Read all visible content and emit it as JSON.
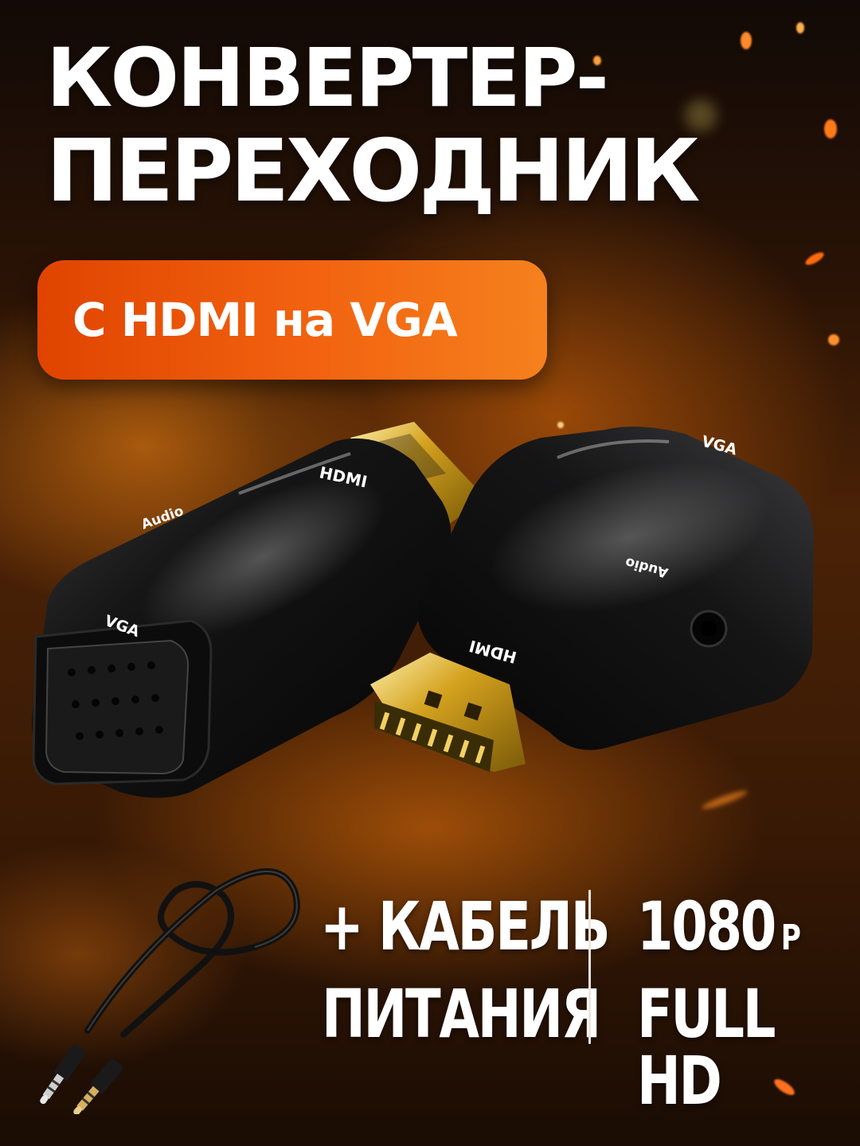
{
  "headline": {
    "line1": "КОНВЕРТЕР-",
    "line2": "ПЕРЕХОДНИК"
  },
  "badge": {
    "text": "С HDMI на VGA",
    "color_start": "#e04400",
    "color_end": "#f5811d"
  },
  "product": {
    "left_adapter": {
      "top_label": "HDMI",
      "side_label": "Audio",
      "front_label": "VGA"
    },
    "right_adapter": {
      "top_label": "VGA",
      "side_label": "Audio",
      "front_label": "HDMI"
    }
  },
  "features": {
    "cable_line1": "+ КАБЕЛЬ",
    "cable_line2": "ПИТАНИЯ",
    "resolution": "1080",
    "resolution_unit": "P",
    "quality": "FULL HD"
  },
  "colors": {
    "text": "#ffffff",
    "background_dark": "#120a06",
    "glow": "#f07a10"
  }
}
